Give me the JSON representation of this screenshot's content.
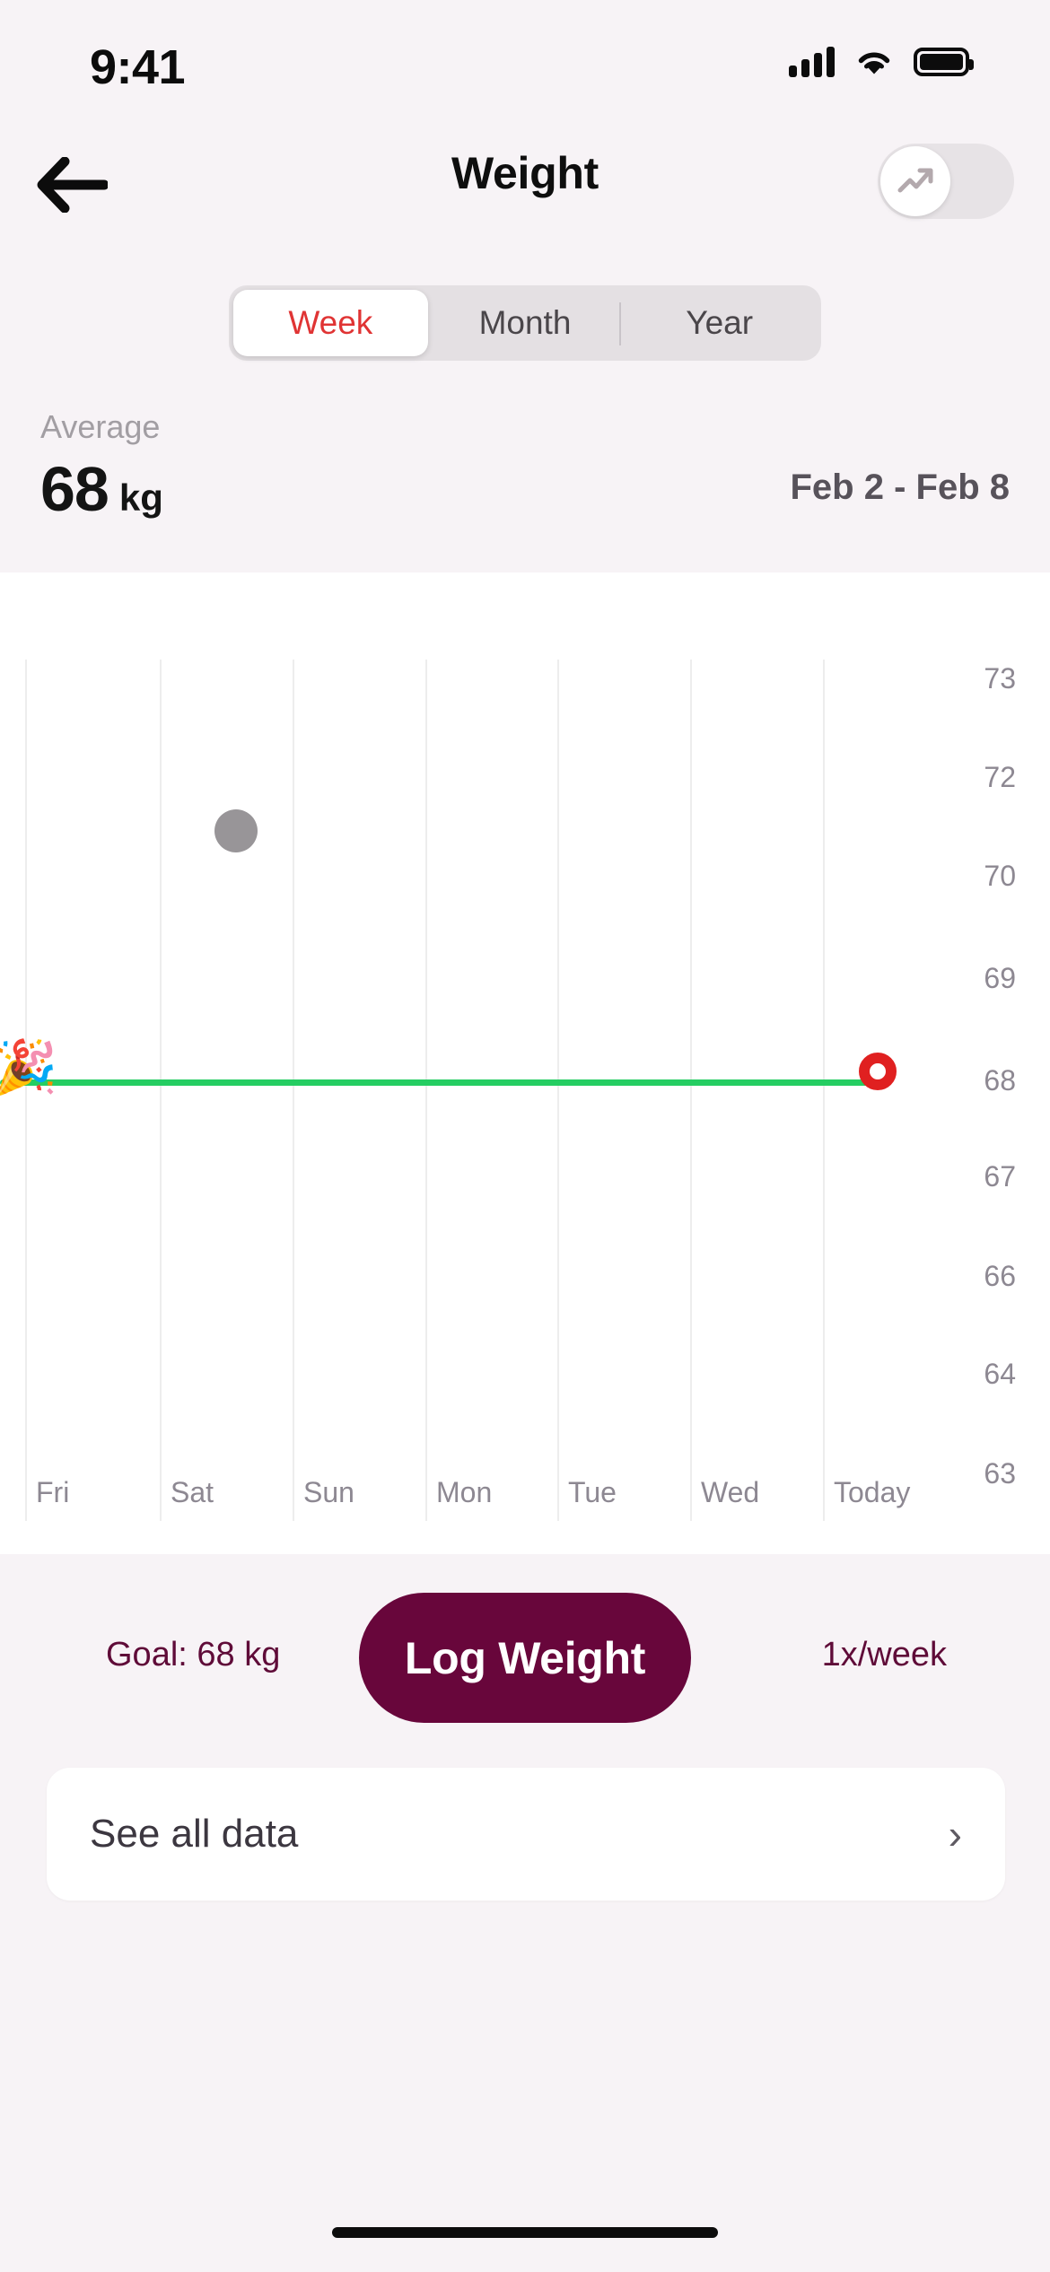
{
  "status_bar": {
    "time": "9:41",
    "cellular_icon": "cellular-signal-icon",
    "wifi_icon": "wifi-icon",
    "battery_icon": "battery-full-icon"
  },
  "nav": {
    "back_icon": "arrow-left-icon",
    "title": "Weight",
    "trend_toggle": {
      "icon": "trending-up-icon",
      "state": "off"
    }
  },
  "range_selector": {
    "options": [
      {
        "label": "Week",
        "selected": true
      },
      {
        "label": "Month",
        "selected": false
      },
      {
        "label": "Year",
        "selected": false
      }
    ]
  },
  "summary": {
    "average_label": "Average",
    "average_value": "68",
    "average_unit": "kg",
    "date_range": "Feb 2 - Feb 8"
  },
  "footer": {
    "goal_text": "Goal: 68 kg",
    "log_button": "Log Weight",
    "frequency_text": "1x/week"
  },
  "see_all": {
    "label": "See all data",
    "chevron_icon": "chevron-right-icon",
    "chevron_glyph": "›"
  },
  "colors": {
    "background": "#f7f3f6",
    "panel": "#ffffff",
    "accent_red": "#e03434",
    "brand_maroon": "#68063b",
    "goal_green": "#25cd62",
    "marker_red": "#e02020",
    "datapoint_gray": "#989598",
    "muted_text": "#8d8892"
  },
  "chart_data": {
    "type": "line",
    "title": "Weight",
    "xlabel": "",
    "ylabel": "kg",
    "categories": [
      "Fri",
      "Sat",
      "Sun",
      "Mon",
      "Tue",
      "Wed",
      "Today"
    ],
    "ytick_labels": [
      "73",
      "72",
      "70",
      "69",
      "68",
      "67",
      "66",
      "64",
      "63"
    ],
    "ylim": [
      63,
      73
    ],
    "grid": true,
    "legend": "none",
    "series": [
      {
        "name": "Weight",
        "points": [
          {
            "x": "Sat",
            "y": 70.9,
            "marker": "dot",
            "color": "#989598"
          }
        ]
      }
    ],
    "goal_line": {
      "value": 68,
      "label": "Goal: 68 kg",
      "color": "#25cd62",
      "start_emoji": "🎉",
      "end_marker": {
        "x": "Today",
        "shape": "ring",
        "color": "#e02020"
      }
    }
  }
}
